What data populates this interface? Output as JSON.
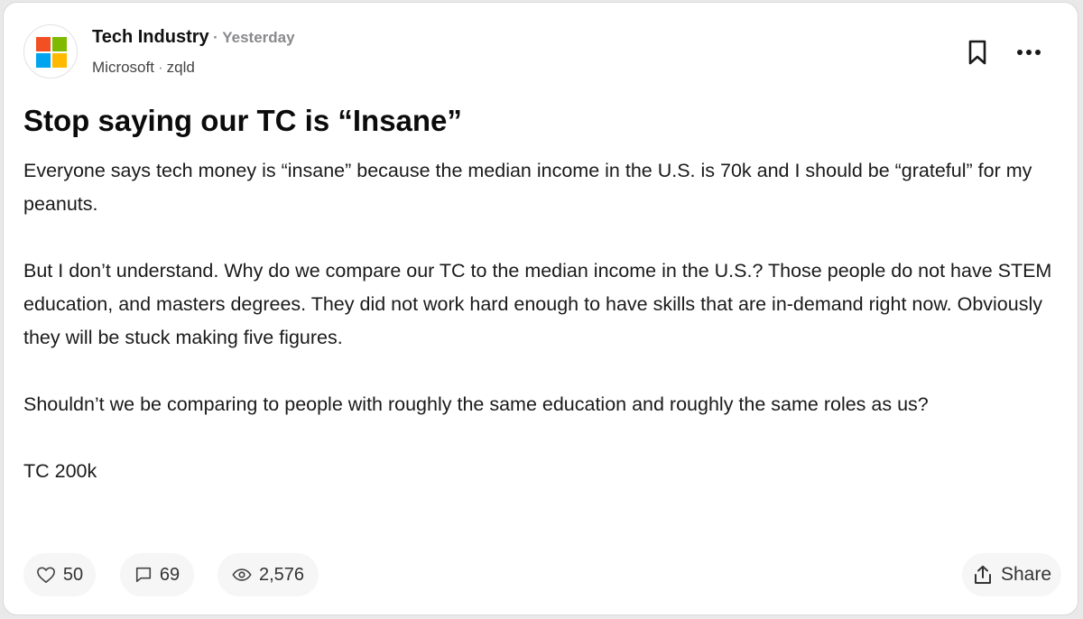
{
  "post": {
    "community": "Tech Industry",
    "separator": "·",
    "time": "Yesterday",
    "company": "Microsoft",
    "author_separator": "·",
    "author": "zqld",
    "title": "Stop saying our TC is “Insane”",
    "paragraphs": [
      "Everyone says tech money is “insane” because the median income in the U.S. is 70k and I should be “grateful” for my peanuts.",
      "But I don’t understand. Why do we compare our TC to the median income in the U.S.?  Those people do not have STEM education, and masters degrees. They did not work hard enough to have skills that are in-demand right now. Obviously they will be stuck making five figures.",
      "Shouldn’t we be comparing to people with roughly the same education and roughly the same roles as us?",
      "TC 200k"
    ]
  },
  "actions": {
    "likes": "50",
    "comments": "69",
    "views": "2,576",
    "share_label": "Share"
  },
  "icons": {
    "logo": "microsoft-logo",
    "bookmark": "bookmark-icon",
    "more": "more-horizontal-icon",
    "like": "heart-icon",
    "comment": "comment-icon",
    "views": "eye-icon",
    "share": "share-icon"
  },
  "colors": {
    "logo_red": "#f25022",
    "logo_green": "#7fba00",
    "logo_blue": "#00a4ef",
    "logo_yellow": "#ffb900",
    "muted_text": "#8a8a8e",
    "pill_bg": "#f6f6f7"
  }
}
